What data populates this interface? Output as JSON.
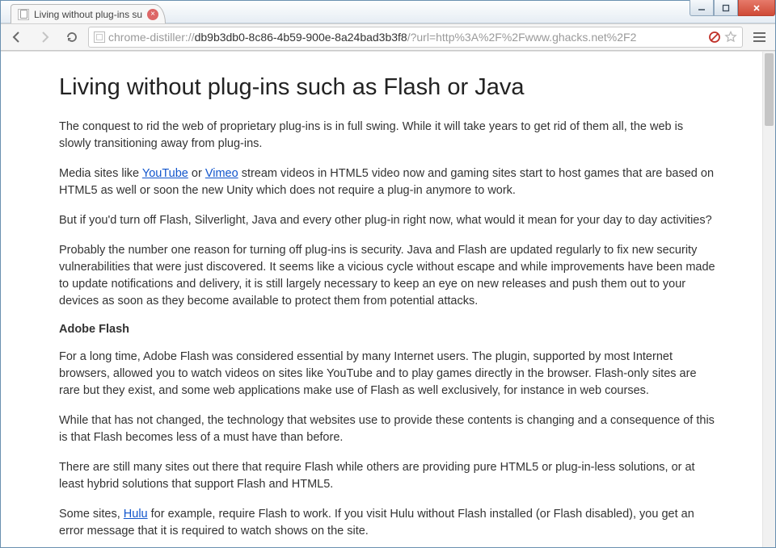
{
  "window": {
    "tab_title": "Living without plug-ins su",
    "controls": {
      "min": "minimize",
      "max": "maximize",
      "close": "close"
    }
  },
  "toolbar": {
    "back": "Back",
    "forward": "Forward",
    "reload": "Reload",
    "url_scheme": "chrome-distiller://",
    "url_bold": "db9b3db0-8c86-4b59-900e-8a24bad3b3f8",
    "url_rest": "/?url=http%3A%2F%2Fwww.ghacks.net%2F2",
    "block_tooltip": "Plugin blocked",
    "star_tooltip": "Bookmark this page",
    "menu": "Menu"
  },
  "article": {
    "title": "Living without plug-ins such as Flash or Java",
    "p1": "The conquest to rid the web of proprietary plug-ins is in full swing. While it will take years to get rid of them all, the web is slowly transitioning away from plug-ins.",
    "p2a": "Media sites like ",
    "link_youtube": "YouTube",
    "p2b": " or ",
    "link_vimeo": "Vimeo",
    "p2c": " stream videos in HTML5 video now and gaming sites start to host games that are based on HTML5 as well or soon the new Unity which does not require a plug-in anymore to work.",
    "p3": "But if you'd turn off Flash, Silverlight, Java and every other plug-in right now, what would it mean for your day to day activities?",
    "p4": "Probably the number one reason for turning off plug-ins is security. Java and Flash are updated regularly to fix new security vulnerabilities that were just discovered. It seems like a vicious cycle without escape and while improvements have been made to update notifications and delivery, it is still largely necessary to keep an eye on new releases and push them out to your devices as soon as they become available to protect them from potential attacks.",
    "h2": "Adobe Flash",
    "p5": "For a long time, Adobe Flash was considered essential by many Internet users. The plugin, supported by most Internet browsers, allowed you to watch videos on sites like YouTube and to play games directly in the browser. Flash-only sites are rare but they exist, and some web applications make use of Flash as well exclusively, for instance in web courses.",
    "p6": "While that has not changed, the technology that websites use to provide these contents is changing and a consequence of this is that Flash becomes less of a must have than before.",
    "p7": "There are still many sites out there that require Flash while others are providing pure HTML5 or plug-in-less solutions, or at least hybrid solutions that support Flash and HTML5.",
    "p8a": "Some sites, ",
    "link_hulu": "Hulu",
    "p8b": " for example, require Flash to work. If you visit Hulu without Flash installed (or Flash disabled), you get an error message that it is required to watch shows on the site."
  }
}
